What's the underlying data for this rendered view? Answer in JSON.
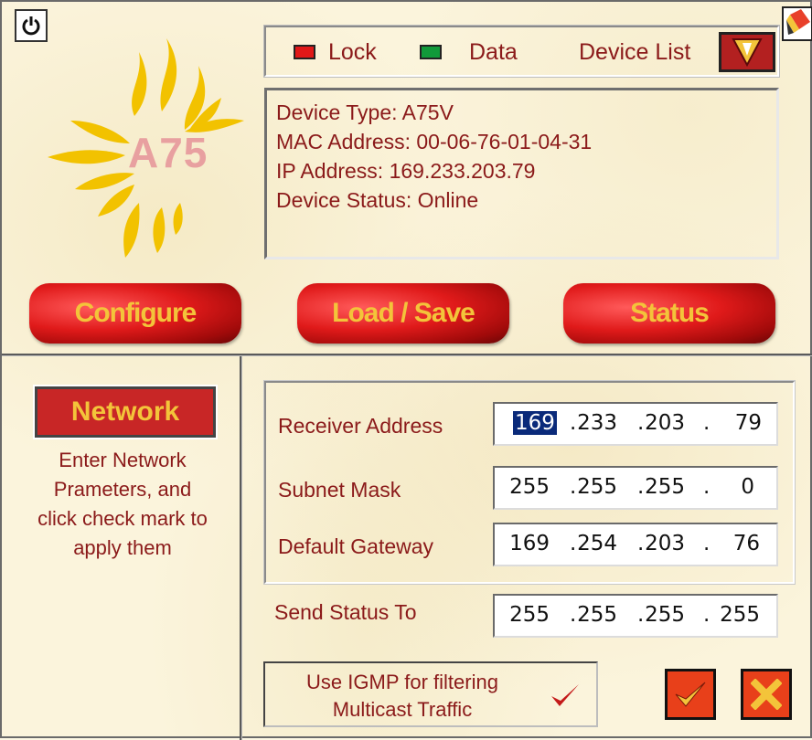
{
  "logo": {
    "text": "A75"
  },
  "indicators": {
    "lock_label": "Lock",
    "data_label": "Data",
    "device_list_label": "Device List",
    "lock_color": "#e01818",
    "data_color": "#119a3a"
  },
  "device_info": {
    "type": "Device Type: A75V",
    "mac": "MAC Address: 00-06-76-01-04-31",
    "ip": "IP Address: 169.233.203.79",
    "status": "Device Status: Online"
  },
  "main_buttons": {
    "configure": "Configure",
    "load_save": "Load / Save",
    "status": "Status"
  },
  "network_panel": {
    "tab_label": "Network",
    "help_line1": "Enter Network",
    "help_line2": "Prameters, and",
    "help_line3": "click check mark to",
    "help_line4": "apply them"
  },
  "fields": {
    "receiver": {
      "label": "Receiver Address",
      "o1": "169",
      "o2": "233",
      "o3": "203",
      "o4": "79"
    },
    "subnet": {
      "label": "Subnet Mask",
      "o1": "255",
      "o2": "255",
      "o3": "255",
      "o4": "0"
    },
    "gateway": {
      "label": "Default Gateway",
      "o1": "169",
      "o2": "254",
      "o3": "203",
      "o4": "76"
    },
    "send_status": {
      "label": "Send Status To",
      "o1": "255",
      "o2": "255",
      "o3": "255",
      "o4": "255"
    }
  },
  "igmp": {
    "line1": "Use IGMP for filtering",
    "line2": "Multicast Traffic",
    "checked": true
  },
  "colors": {
    "text_accent": "#8b1a1a",
    "button_gold": "#f3c43a",
    "button_red": "#e01a1a"
  }
}
